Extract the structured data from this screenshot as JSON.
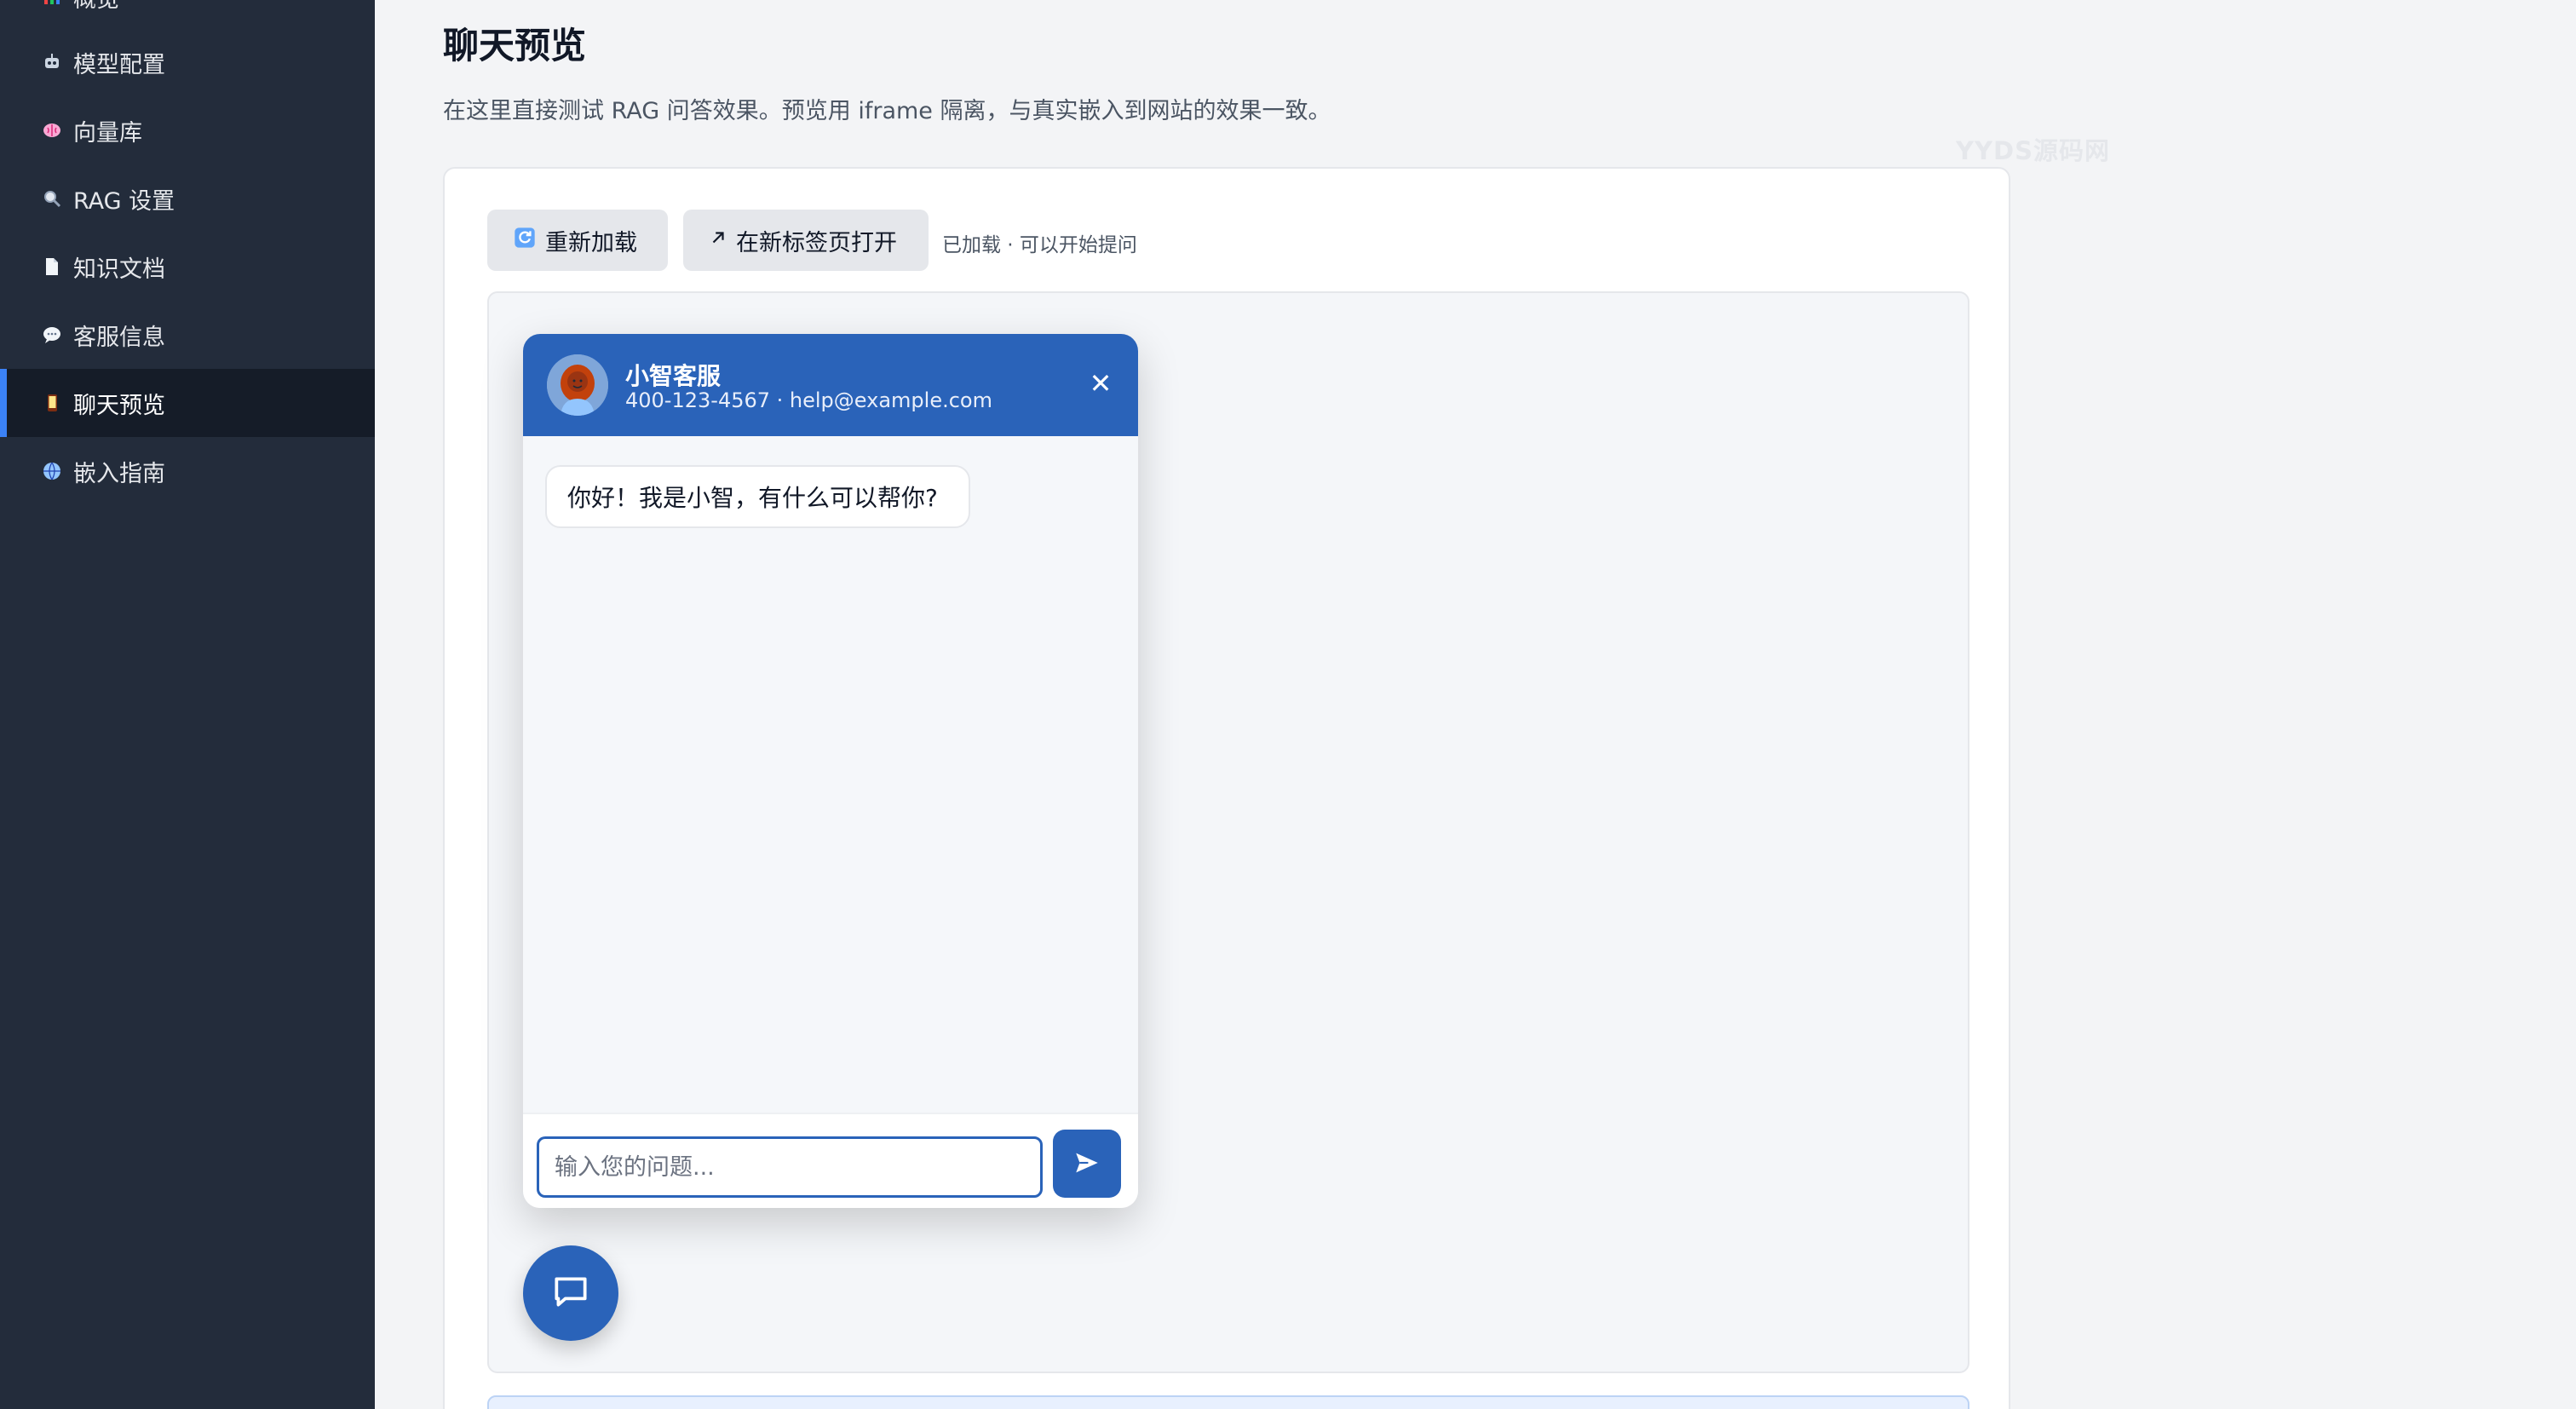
{
  "sidebar": {
    "items": [
      {
        "icon": "chart-icon",
        "label": "概览",
        "active": false
      },
      {
        "icon": "robot-icon",
        "label": "模型配置",
        "active": false
      },
      {
        "icon": "brain-icon",
        "label": "向量库",
        "active": false
      },
      {
        "icon": "magnifier-icon",
        "label": "RAG 设置",
        "active": false
      },
      {
        "icon": "document-icon",
        "label": "知识文档",
        "active": false
      },
      {
        "icon": "speech-bubble-icon",
        "label": "客服信息",
        "active": false
      },
      {
        "icon": "phone-icon",
        "label": "聊天预览",
        "active": true
      },
      {
        "icon": "globe-icon",
        "label": "嵌入指南",
        "active": false
      }
    ],
    "accent_color": "#3b82f6"
  },
  "main": {
    "title": "聊天预览",
    "description": "在这里直接测试 RAG 问答效果。预览用 iframe 隔离，与真实嵌入到网站的效果一致。",
    "watermark": "YYDS源码网",
    "toolbar": {
      "reload_icon": "refresh-icon",
      "reload_label": "重新加载",
      "newtab_icon": "external-arrow-icon",
      "newtab_label": "在新标签页打开",
      "status": "已加载 · 可以开始提问"
    }
  },
  "widget": {
    "header_color": "#2a63b9",
    "name": "小智客服",
    "contact": "400-123-4567 · help@example.com",
    "close_symbol": "✕",
    "messages": [
      {
        "from": "bot",
        "text": "你好！我是小智，有什么可以帮你?"
      }
    ],
    "input_placeholder": "输入您的问题...",
    "input_value": "",
    "send_icon": "send-icon",
    "launcher_icon": "chat-bubble-icon"
  }
}
